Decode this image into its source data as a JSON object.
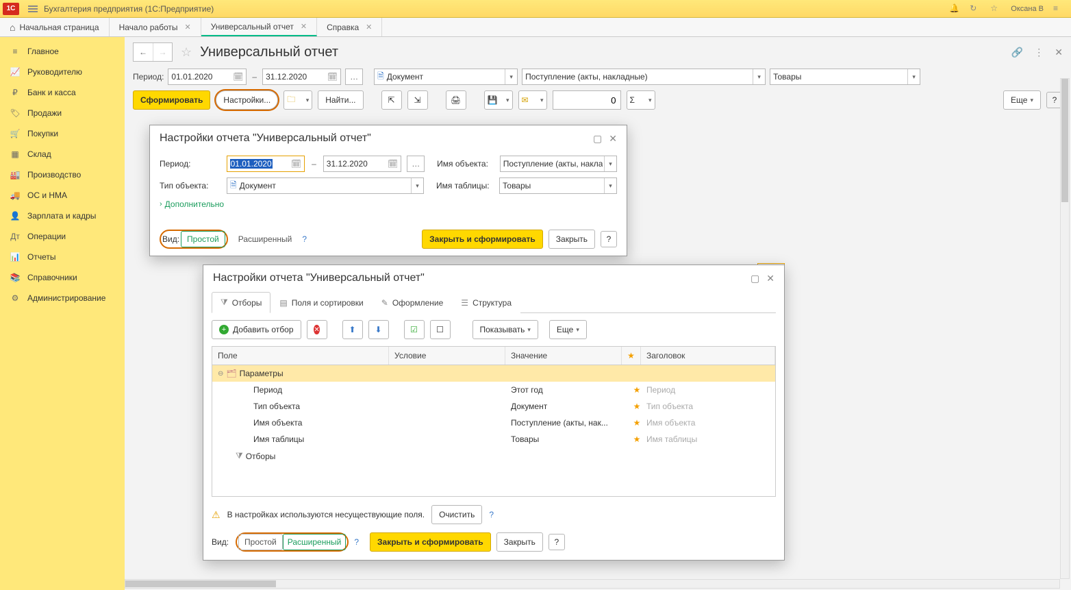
{
  "app": {
    "title": "Бухгалтерия предприятия  (1С:Предприятие)",
    "user": "Оксана В"
  },
  "tabs": {
    "home": "Начальная страница",
    "t1": "Начало работы",
    "t2": "Универсальный отчет",
    "t3": "Справка"
  },
  "sidebar": [
    {
      "icon": "≡",
      "label": "Главное"
    },
    {
      "icon": "📈",
      "label": "Руководителю"
    },
    {
      "icon": "₽",
      "label": "Банк и касса"
    },
    {
      "icon": "🏷",
      "label": "Продажи"
    },
    {
      "icon": "🛒",
      "label": "Покупки"
    },
    {
      "icon": "▦",
      "label": "Склад"
    },
    {
      "icon": "🏭",
      "label": "Производство"
    },
    {
      "icon": "🚚",
      "label": "ОС и НМА"
    },
    {
      "icon": "👤",
      "label": "Зарплата и кадры"
    },
    {
      "icon": "Дт",
      "label": "Операции"
    },
    {
      "icon": "📊",
      "label": "Отчеты"
    },
    {
      "icon": "📚",
      "label": "Справочники"
    },
    {
      "icon": "⚙",
      "label": "Администрирование"
    }
  ],
  "page": {
    "title": "Универсальный отчет"
  },
  "filters": {
    "period_lbl": "Период:",
    "from": "01.01.2020",
    "to": "31.12.2020",
    "obj_type": "Документ",
    "obj_name": "Поступление (акты, накладные)",
    "table_name": "Товары"
  },
  "toolbar": {
    "generate": "Сформировать",
    "settings": "Настройки...",
    "find": "Найти...",
    "num": "0",
    "more": "Еще"
  },
  "dlg1": {
    "title": "Настройки отчета \"Универсальный отчет\"",
    "period_lbl": "Период:",
    "from": "01.01.2020",
    "to": "31.12.2020",
    "obj_name_lbl": "Имя объекта:",
    "obj_name": "Поступление (акты, накла",
    "obj_type_lbl": "Тип объекта:",
    "obj_type": "Документ",
    "table_lbl": "Имя таблицы:",
    "table": "Товары",
    "more": "Дополнительно",
    "vid_lbl": "Вид:",
    "vid_simple": "Простой",
    "vid_adv": "Расширенный",
    "close_gen": "Закрыть и сформировать",
    "close": "Закрыть"
  },
  "dlg2": {
    "title": "Настройки отчета \"Универсальный отчет\"",
    "tabs": {
      "t1": "Отборы",
      "t2": "Поля и сортировки",
      "t3": "Оформление",
      "t4": "Структура"
    },
    "tb": {
      "add": "Добавить отбор",
      "show": "Показывать",
      "more": "Еще"
    },
    "cols": {
      "c1": "Поле",
      "c2": "Условие",
      "c3": "Значение",
      "c5": "Заголовок"
    },
    "rows_hdr": {
      "label": "Параметры"
    },
    "rows": [
      {
        "c1": "Период",
        "c3": "Этот год",
        "c5": "Период"
      },
      {
        "c1": "Тип объекта",
        "c3": "Документ",
        "c5": "Тип объекта"
      },
      {
        "c1": "Имя объекта",
        "c3": "Поступление (акты, нак...",
        "c5": "Имя объекта"
      },
      {
        "c1": "Имя таблицы",
        "c3": "Товары",
        "c5": "Имя таблицы"
      }
    ],
    "filters_label": "Отборы",
    "warn": "В настройках используются несуществующие поля.",
    "clear": "Очистить",
    "vid_lbl": "Вид:",
    "vid_simple": "Простой",
    "vid_adv": "Расширенный",
    "close_gen": "Закрыть и сформировать",
    "close": "Закрыть"
  }
}
